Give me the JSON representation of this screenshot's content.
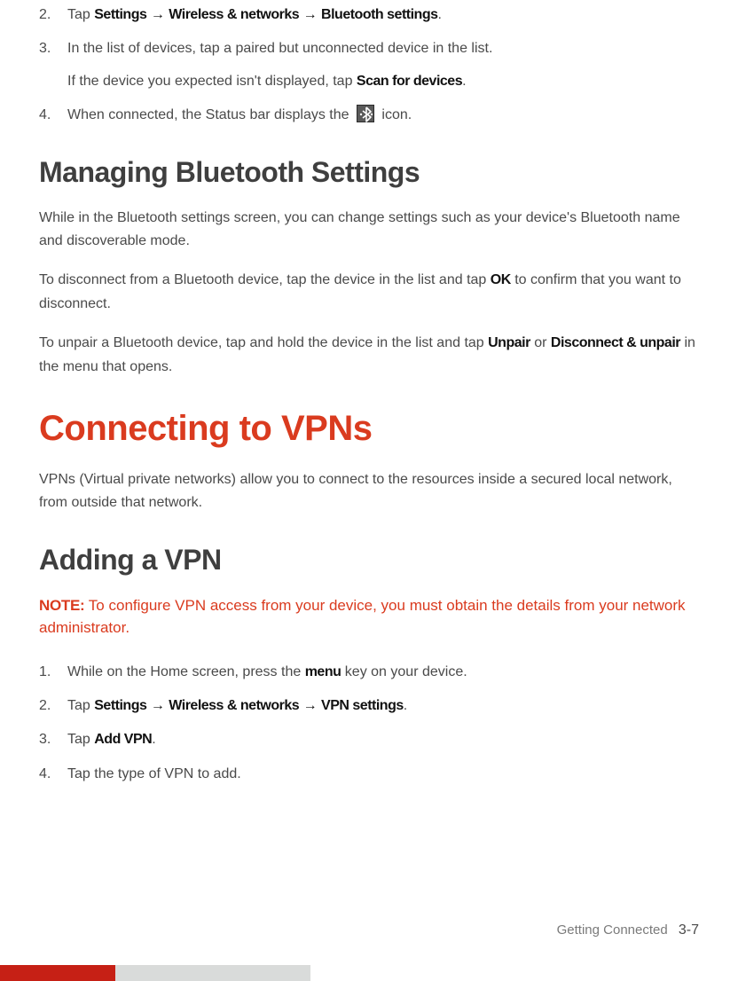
{
  "list_top": {
    "i2_num": "2.",
    "i2_pre": "Tap ",
    "i2_p1": "Settings",
    "i2_p2": "Wireless & networks",
    "i2_p3": "Bluetooth settings",
    "i2_suf": ".",
    "i3_num": "3.",
    "i3_line1": "In the list of devices, tap a paired but unconnected device in the list.",
    "i3_line2_pre": "If the device you expected isn't displayed, tap ",
    "i3_line2_bold": "Scan for devices",
    "i3_line2_suf": ".",
    "i4_num": "4.",
    "i4_pre": "When connected, the Status bar displays the ",
    "i4_suf": " icon."
  },
  "h_manage": "Managing Bluetooth Settings",
  "p_manage1": "While in the Bluetooth settings screen, you can change settings such as your device's Bluetooth name and discoverable mode.",
  "p_manage2_pre": "To disconnect from a Bluetooth device, tap the device in the list and tap ",
  "p_manage2_b": "OK",
  "p_manage2_suf": " to confirm that you want to disconnect.",
  "p_manage3_pre": "To unpair a Bluetooth device, tap and hold the device in the list and tap ",
  "p_manage3_b1": "Unpair",
  "p_manage3_mid": " or ",
  "p_manage3_b2": "Disconnect & unpair",
  "p_manage3_suf": " in the menu that opens.",
  "h_vpn": "Connecting to VPNs",
  "p_vpn1": "VPNs (Virtual private networks) allow you to connect to the resources inside a secured local network, from outside that network.",
  "h_addvpn": "Adding a VPN",
  "note_label": "NOTE:",
  "note_text": " To configure VPN access from your device, you must obtain the details from your network administrator.",
  "list_vpn": {
    "i1_num": "1.",
    "i1_pre": "While on the Home screen, press the ",
    "i1_b": "menu",
    "i1_suf": " key on your device.",
    "i2_num": "2.",
    "i2_pre": "Tap ",
    "i2_p1": "Settings",
    "i2_p2": "Wireless & networks",
    "i2_p3": "VPN settings",
    "i2_suf": ".",
    "i3_num": "3.",
    "i3_pre": "Tap ",
    "i3_b": "Add VPN",
    "i3_suf": ".",
    "i4_num": "4.",
    "i4_text": "Tap the type of VPN to add."
  },
  "footer_section": "Getting Connected",
  "footer_page": "3-7",
  "arrow": "→"
}
